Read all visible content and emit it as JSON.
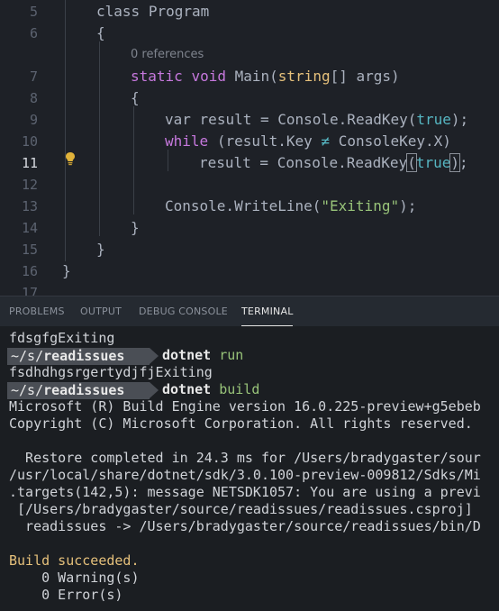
{
  "editor": {
    "line_numbers": [
      "5",
      "6",
      "7",
      "8",
      "9",
      "10",
      "11",
      "12",
      "13",
      "14",
      "15",
      "16",
      "17"
    ],
    "active_line": "11",
    "codelens": "0 references",
    "code": {
      "class_kw": "class",
      "class_name": "Program",
      "brace_open": "{",
      "brace_close": "}",
      "static_kw": "static",
      "void_kw": "void",
      "main_name": "Main(",
      "string_kw": "string",
      "params_rest": "[] args)",
      "var_kw": "var",
      "line9_mid": "result = Console.ReadKey(",
      "true_kw": "true",
      "line9_end": ");",
      "while_kw": "while",
      "line10_a": "(result.Key",
      "neq_op": "≠",
      "line10_b": "ConsoleKey.X)",
      "line11_a": "result = Console.ReadKey",
      "paren_open": "(",
      "paren_close": ")",
      "semicolon": ";",
      "line13_a": "Console.WriteLine(",
      "exiting_str": "\"Exiting\"",
      "line13_b": ");"
    }
  },
  "panel": {
    "tabs": [
      "PROBLEMS",
      "OUTPUT",
      "DEBUG CONSOLE",
      "TERMINAL"
    ],
    "active_tab": "TERMINAL"
  },
  "terminal": {
    "line1": "fdsgfgExiting",
    "prompt1_path": "~/s/",
    "prompt1_dir": "readissues",
    "cmd1_bin": "dotnet",
    "cmd1_arg": "run",
    "line3": "fsdhdhgsrgertydjfjExiting",
    "prompt2_path": "~/s/",
    "prompt2_dir": "readissues",
    "cmd2_bin": "dotnet",
    "cmd2_arg": "build",
    "out1": "Microsoft (R) Build Engine version 16.0.225-preview+g5ebeb",
    "out2": "Copyright (C) Microsoft Corporation. All rights reserved.",
    "out3": "  Restore completed in 24.3 ms for /Users/bradygaster/sour",
    "out4": "/usr/local/share/dotnet/sdk/3.0.100-preview-009812/Sdks/Mi",
    "out5": ".targets(142,5): message NETSDK1057: You are using a previ",
    "out6": " [/Users/bradygaster/source/readissues/readissues.csproj]",
    "out7": "  readissues -> /Users/bradygaster/source/readissues/bin/D",
    "success": "Build succeeded.",
    "warnings": "    0 Warning(s)",
    "errors": "    0 Error(s)"
  }
}
